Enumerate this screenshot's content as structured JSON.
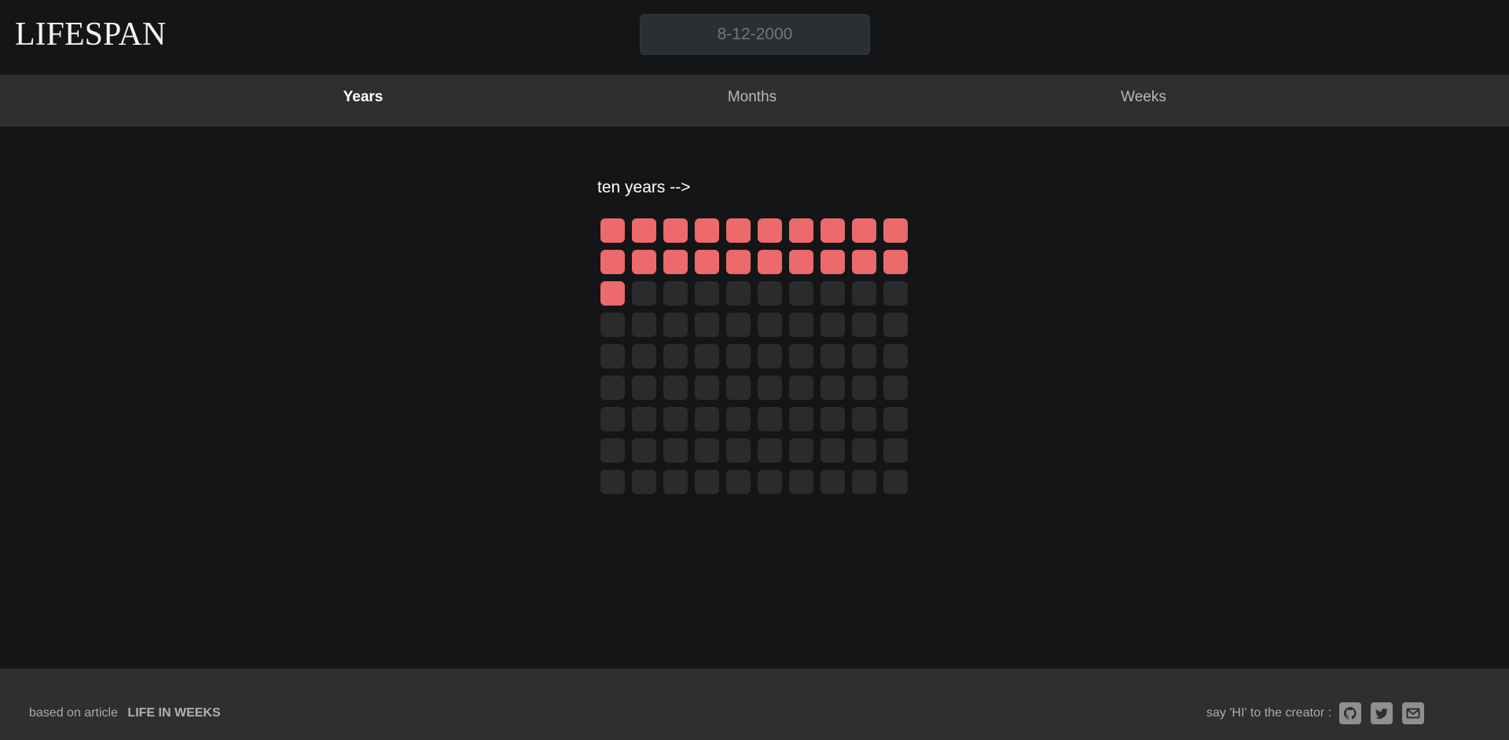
{
  "header": {
    "logo": "LIFESPAN",
    "date_input": {
      "value": "",
      "placeholder": "8-12-2000"
    }
  },
  "tabs": [
    {
      "label": "Years",
      "active": true
    },
    {
      "label": "Months",
      "active": false
    },
    {
      "label": "Weeks",
      "active": false
    }
  ],
  "grid": {
    "label": "ten years -->",
    "columns": 10,
    "rows": 9,
    "total_cells": 90,
    "lived_cells": 21,
    "lived_color": "#ec6a6b",
    "empty_color": "#2a2b2d"
  },
  "footer": {
    "based_on": "based on article",
    "article_link": "LIFE IN WEEKS",
    "say_hi": "say 'HI' to the creator :",
    "social_icons": [
      "github-icon",
      "twitter-icon",
      "email-icon"
    ]
  },
  "colors": {
    "background": "#141517",
    "bar": "#2e2f31",
    "accent": "#ec6a6b"
  }
}
